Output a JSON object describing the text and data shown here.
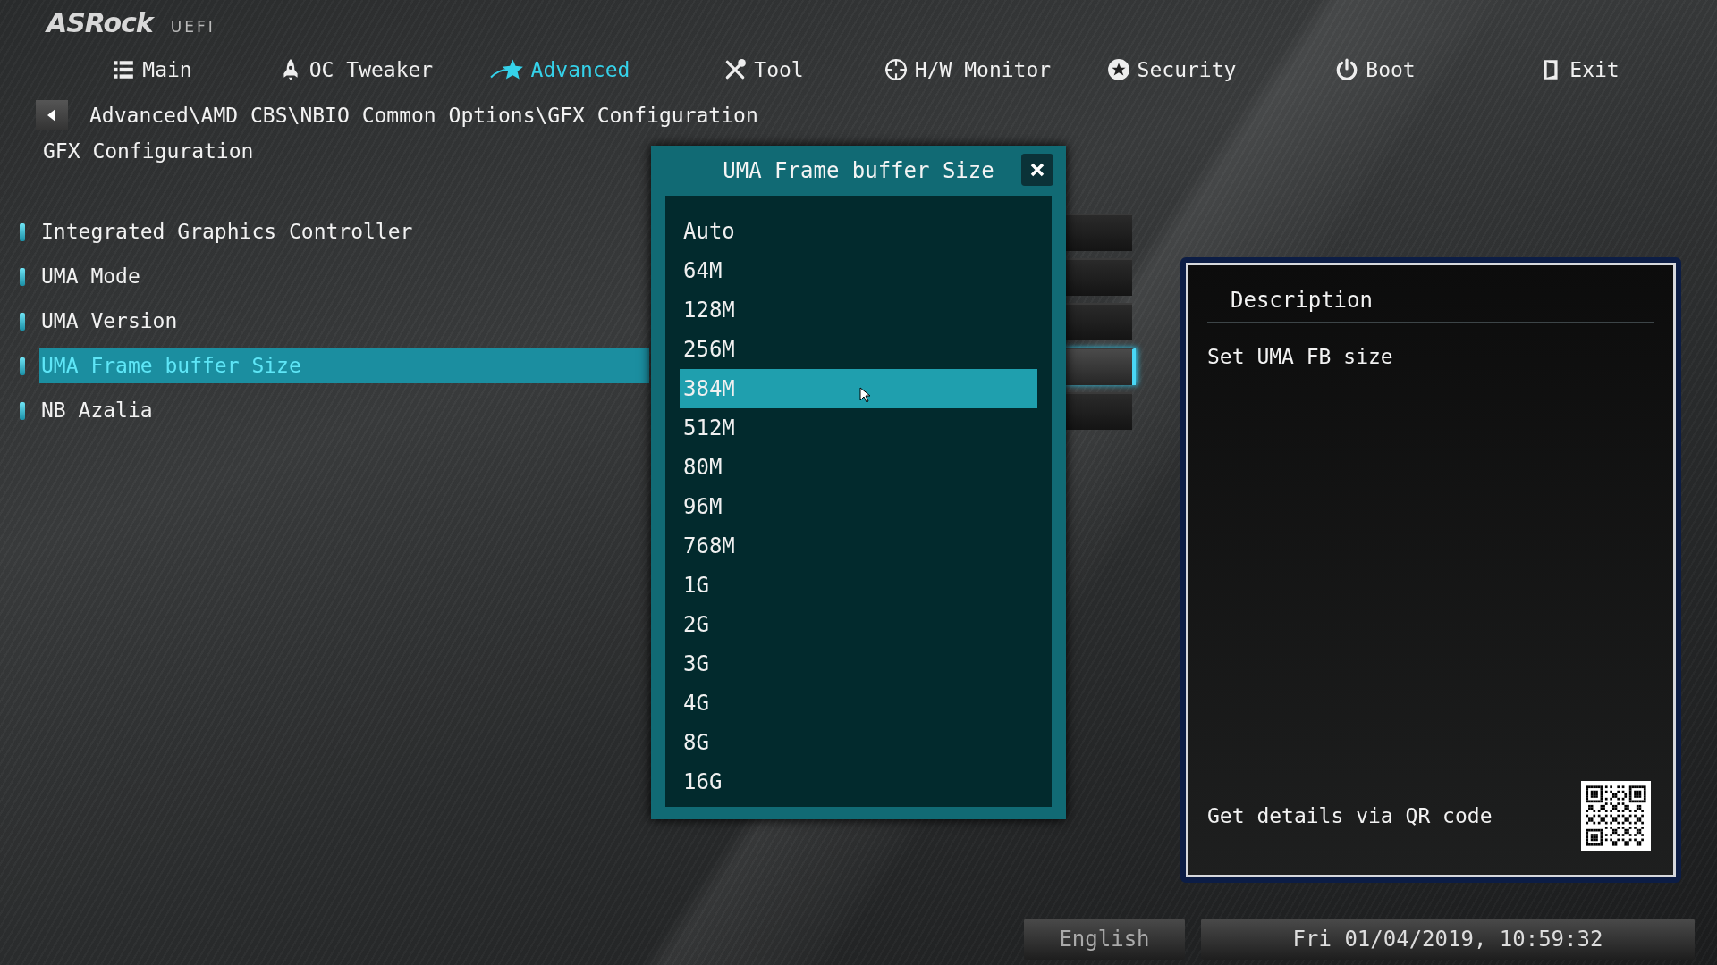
{
  "logo": {
    "brand": "ASRock",
    "suffix": "UEFI"
  },
  "tabs": [
    {
      "label": "Main",
      "selected": false
    },
    {
      "label": "OC Tweaker",
      "selected": false
    },
    {
      "label": "Advanced",
      "selected": true
    },
    {
      "label": "Tool",
      "selected": false
    },
    {
      "label": "H/W Monitor",
      "selected": false
    },
    {
      "label": "Security",
      "selected": false
    },
    {
      "label": "Boot",
      "selected": false
    },
    {
      "label": "Exit",
      "selected": false
    }
  ],
  "breadcrumb": "Advanced\\AMD CBS\\NBIO Common Options\\GFX Configuration",
  "page_title": "GFX Configuration",
  "settings": [
    {
      "label": "Integrated Graphics Controller",
      "selected": false
    },
    {
      "label": "UMA Mode",
      "selected": false
    },
    {
      "label": "UMA Version",
      "selected": false
    },
    {
      "label": "UMA Frame buffer Size",
      "selected": true
    },
    {
      "label": "NB Azalia",
      "selected": false
    }
  ],
  "dialog": {
    "title": "UMA Frame buffer Size",
    "options": [
      {
        "label": "Auto",
        "selected": false
      },
      {
        "label": "64M",
        "selected": false
      },
      {
        "label": "128M",
        "selected": false
      },
      {
        "label": "256M",
        "selected": false
      },
      {
        "label": "384M",
        "selected": true
      },
      {
        "label": "512M",
        "selected": false
      },
      {
        "label": "80M",
        "selected": false
      },
      {
        "label": "96M",
        "selected": false
      },
      {
        "label": "768M",
        "selected": false
      },
      {
        "label": "1G",
        "selected": false
      },
      {
        "label": "2G",
        "selected": false
      },
      {
        "label": "3G",
        "selected": false
      },
      {
        "label": "4G",
        "selected": false
      },
      {
        "label": "8G",
        "selected": false
      },
      {
        "label": "16G",
        "selected": false
      }
    ]
  },
  "description": {
    "heading": "Description",
    "text": "Set UMA FB size",
    "qr_caption": "Get details via QR code"
  },
  "status_bar": {
    "language": "English",
    "datetime": "Fri 01/04/2019, 10:59:32"
  }
}
